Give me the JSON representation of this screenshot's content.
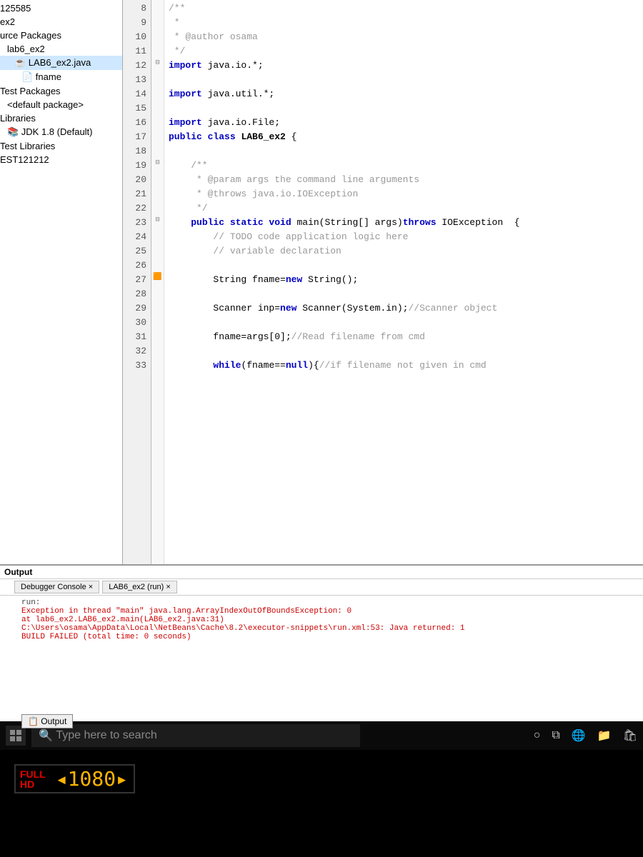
{
  "tree": {
    "items": [
      {
        "label": "125585",
        "indent": "i1"
      },
      {
        "label": "ex2",
        "indent": "i1"
      },
      {
        "label": "urce Packages",
        "indent": "i1"
      },
      {
        "label": "lab6_ex2",
        "indent": "i2"
      },
      {
        "label": "LAB6_ex2.java",
        "indent": "i3",
        "sel": true,
        "icon": "☕"
      },
      {
        "label": "fname",
        "indent": "i4",
        "icon": "📄"
      },
      {
        "label": "Test Packages",
        "indent": "i1"
      },
      {
        "label": "<default package>",
        "indent": "i2"
      },
      {
        "label": "Libraries",
        "indent": "i1"
      },
      {
        "label": "JDK 1.8 (Default)",
        "indent": "i2",
        "icon": "📚"
      },
      {
        "label": "Test Libraries",
        "indent": "i1"
      },
      {
        "label": "EST121212",
        "indent": "i1"
      }
    ]
  },
  "editor": {
    "first_line": 8,
    "last_line": 33,
    "fold_markers": {
      "12": "⊟",
      "19": "⊟",
      "23": "⊟"
    },
    "breakpoint_line": 27,
    "lines": {
      "8": {
        "text": "/**",
        "cls": "com"
      },
      "9": {
        "text": " *",
        "cls": "com"
      },
      "10": {
        "text": " * @author osama",
        "cls": "com"
      },
      "11": {
        "text": " */",
        "cls": "com"
      },
      "12": {
        "html": "<span class='kw'>import</span> java.io.*;"
      },
      "13": {
        "text": ""
      },
      "14": {
        "html": "<span class='kw'>import</span> java.util.*;"
      },
      "15": {
        "text": ""
      },
      "16": {
        "html": "<span class='kw'>import</span> java.io.File;"
      },
      "17": {
        "html": "<span class='kw'>public class</span> <span class='cls'>LAB6_ex2</span> {"
      },
      "18": {
        "text": ""
      },
      "19": {
        "text": "    /**",
        "cls": "com"
      },
      "20": {
        "text": "     * @param args the command line arguments",
        "cls": "com"
      },
      "21": {
        "text": "     * @throws java.io.IOException",
        "cls": "com"
      },
      "22": {
        "text": "     */",
        "cls": "com"
      },
      "23": {
        "html": "    <span class='kw'>public static void</span> main(String[] args)<span class='kw'>throws</span> IOException  {"
      },
      "24": {
        "text": "        // TODO code application logic here",
        "cls": "com"
      },
      "25": {
        "text": "        // variable declaration",
        "cls": "com"
      },
      "26": {
        "text": ""
      },
      "27": {
        "html": "        String fname=<span class='kw'>new</span> String();"
      },
      "28": {
        "text": ""
      },
      "29": {
        "html": "        Scanner inp=<span class='kw'>new</span> Scanner(System.in);<span class='com'>//Scanner object</span>"
      },
      "30": {
        "text": ""
      },
      "31": {
        "html": "        fname=args[0];<span class='com'>//Read filename from cmd</span>"
      },
      "32": {
        "text": ""
      },
      "33": {
        "html": "        <span class='kw'>while</span>(fname==<span class='kw'>null</span>){<span class='com'>//if filename not given in cmd</span>"
      }
    }
  },
  "output": {
    "title": "Output",
    "tabs": [
      "Debugger Console ×",
      "LAB6_ex2 (run) ×"
    ],
    "lines": [
      {
        "text": "run:"
      },
      {
        "text": "Exception in thread \"main\" java.lang.ArrayIndexOutOfBoundsException: 0",
        "err": true
      },
      {
        "text": "        at lab6_ex2.LAB6_ex2.main(LAB6_ex2.java:31)",
        "err": true
      },
      {
        "text": "C:\\Users\\osama\\AppData\\Local\\NetBeans\\Cache\\8.2\\executor-snippets\\run.xml:53: Java returned: 1",
        "err": true
      },
      {
        "text": "BUILD FAILED (total time: 0 seconds)",
        "err": true
      }
    ],
    "pinned": "Output"
  },
  "taskbar": {
    "search_placeholder": "Type here to search"
  },
  "badge": {
    "left_top": "FULL",
    "left_bot": "HD",
    "right": "1080"
  }
}
